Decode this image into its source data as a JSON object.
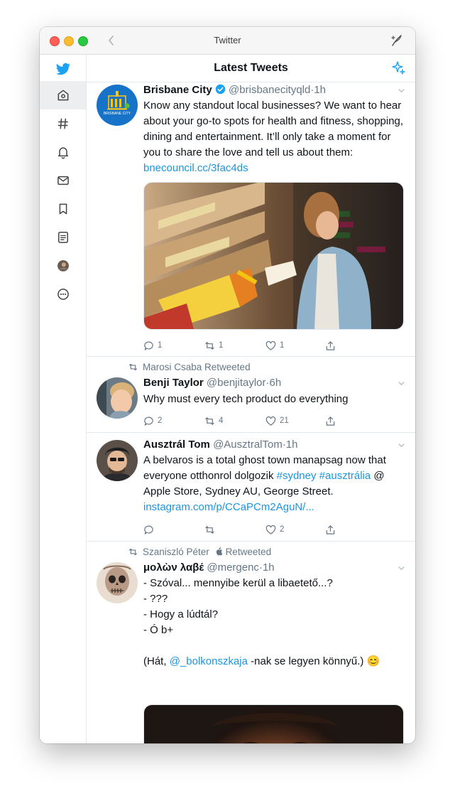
{
  "window": {
    "title": "Twitter"
  },
  "header": {
    "title": "Latest Tweets"
  },
  "sidebar": {
    "items": [
      {
        "name": "home",
        "icon": "home-icon"
      },
      {
        "name": "explore",
        "icon": "hashtag-icon"
      },
      {
        "name": "notifications",
        "icon": "bell-icon"
      },
      {
        "name": "messages",
        "icon": "mail-icon"
      },
      {
        "name": "bookmarks",
        "icon": "bookmark-icon"
      },
      {
        "name": "lists",
        "icon": "list-icon"
      },
      {
        "name": "profile",
        "icon": "avatar"
      },
      {
        "name": "more",
        "icon": "more-icon"
      }
    ]
  },
  "tweets": [
    {
      "name": "Brisbane City",
      "handle": "@brisbanecityqld",
      "time": "1h",
      "verified": true,
      "body": "Know any standout local businesses? We want to hear about your go-to spots for health and fitness, shopping, dining and entertainment. It’ll only take a moment for you to share the love and tell us about them: ",
      "link": "bnecouncil.cc/3fac4ds",
      "avatar_text": "BRISBANE CITY",
      "counts": {
        "reply": "1",
        "retweet": "1",
        "like": "1"
      }
    },
    {
      "retweeted_by": "Marosi Csaba Retweeted",
      "name": "Benji Taylor",
      "handle": "@benjitaylor",
      "time": "6h",
      "body": "Why must every tech product do everything",
      "counts": {
        "reply": "2",
        "retweet": "4",
        "like": "21"
      }
    },
    {
      "name": "Ausztrál Tom",
      "handle": "@AusztralTom",
      "time": "1h",
      "body_prefix": "A belvaros is a total ghost town manapsag now that everyone otthonrol dolgozik ",
      "hashtag1": "#sydney",
      "hashtag2": "#ausztrália",
      "body_suffix": " @ Apple Store, Sydney AU, George Street.",
      "link": "instagram.com/p/CCaPCm2AguN/...",
      "counts": {
        "reply": "",
        "retweet": "",
        "like": "2"
      }
    },
    {
      "retweeted_by_name": "Szaniszló Péter",
      "retweeted_by_label": "Retweeted",
      "name": "μολὼν λαβέ",
      "handle": "@mergenc",
      "time": "1h",
      "lines": [
        "- Szóval... mennyibe kerül a libaetető...?",
        "- ???",
        "- Hogy a lúdtál?",
        "- Ó b+"
      ],
      "reply_prefix": "(Hát, ",
      "mention": "@_bolkonszkaja",
      "reply_suffix": " -nak se legyen könnyű.) 😊"
    }
  ],
  "colors": {
    "accent": "#1da1f2",
    "link": "#1b95e0",
    "meta": "#657786",
    "border": "#e1e8ed"
  }
}
